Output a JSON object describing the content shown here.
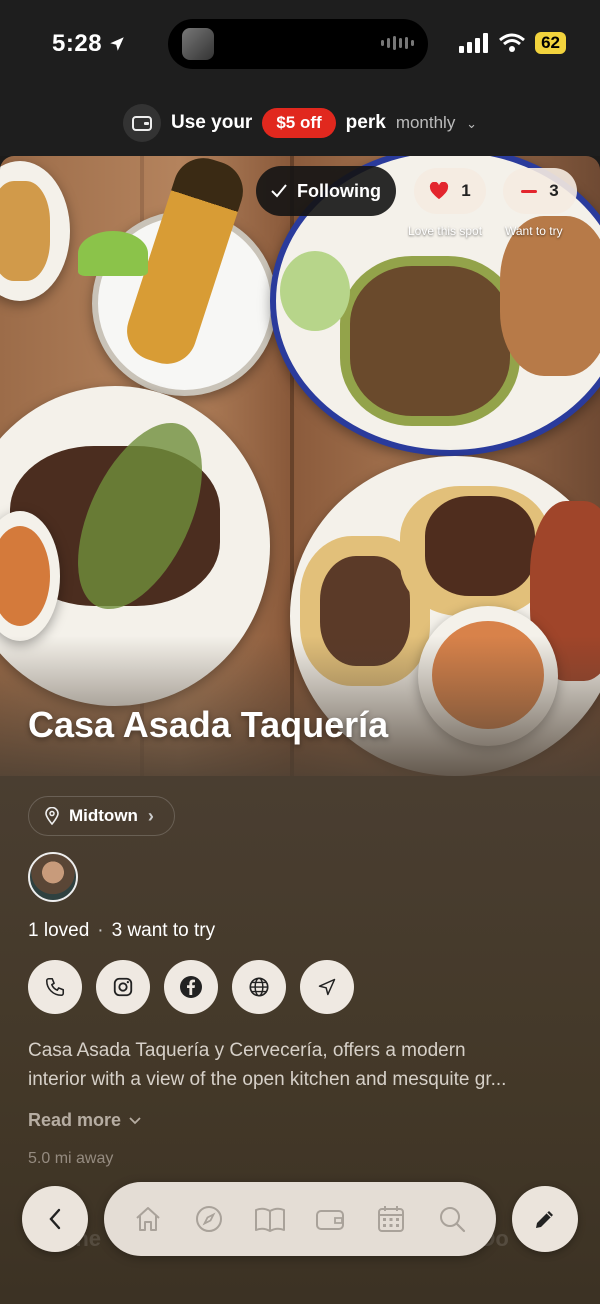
{
  "status_bar": {
    "time": "5:28",
    "battery": "62"
  },
  "perk_bar": {
    "prefix": "Use your",
    "badge": "$5 off",
    "suffix": "perk",
    "period": "monthly"
  },
  "hero": {
    "following_label": "Following",
    "love_count": "1",
    "love_caption": "Love this spot",
    "want_count": "3",
    "want_caption": "Want to try"
  },
  "restaurant": {
    "name": "Casa Asada Taquería",
    "neighborhood": "Midtown",
    "loved": "1 loved",
    "want_to_try": "3 want to try",
    "description_line1": "Casa Asada Taquería y Cervecería, offers a modern",
    "description_line2": "interior with a view of the open kitchen and mesquite gr...",
    "read_more": "Read more",
    "distance": "5.0 mi away"
  },
  "actions": [
    "phone-icon",
    "instagram-icon",
    "facebook-icon",
    "globe-icon",
    "navigation-icon"
  ],
  "bottom": {
    "ghost_left": "Done",
    "ghost_right": "t Do",
    "tabs": [
      "home-icon",
      "compass-icon",
      "book-icon",
      "wallet-icon",
      "calendar-icon",
      "search-icon"
    ]
  },
  "colors": {
    "perk_red": "#e1281e",
    "battery_yellow": "#f2d33d",
    "content_bg": "#4a3e31",
    "heart_red": "#e3262e"
  }
}
